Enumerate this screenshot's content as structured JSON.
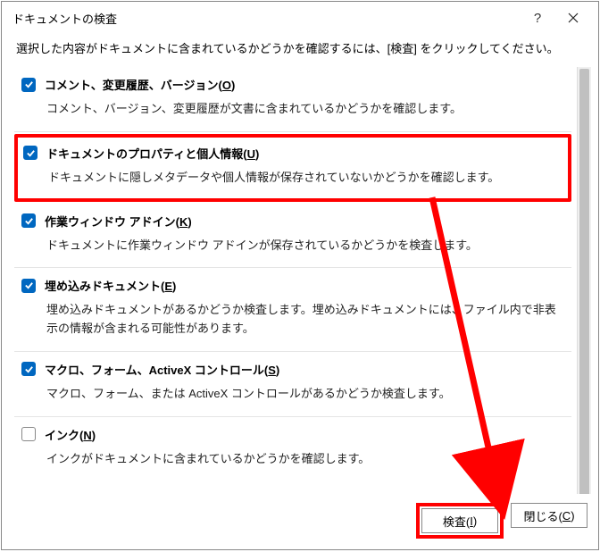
{
  "title": "ドキュメントの検査",
  "instruction": "選択した内容がドキュメントに含まれているかどうかを確認するには、[検査] をクリックしてください。",
  "items": [
    {
      "checked": true,
      "highlighted": false,
      "title_pre": "コメント、変更履歴、バージョン(",
      "title_key": "O",
      "title_post": ")",
      "desc": "コメント、バージョン、変更履歴が文書に含まれているかどうかを確認します。"
    },
    {
      "checked": true,
      "highlighted": true,
      "title_pre": "ドキュメントのプロパティと個人情報(",
      "title_key": "U",
      "title_post": ")",
      "desc": "ドキュメントに隠しメタデータや個人情報が保存されていないかどうかを確認します。"
    },
    {
      "checked": true,
      "highlighted": false,
      "title_pre": "作業ウィンドウ アドイン(",
      "title_key": "K",
      "title_post": ")",
      "desc": "ドキュメントに作業ウィンドウ アドインが保存されているかどうかを検査します。"
    },
    {
      "checked": true,
      "highlighted": false,
      "title_pre": "埋め込みドキュメント(",
      "title_key": "E",
      "title_post": ")",
      "desc": "埋め込みドキュメントがあるかどうか検査します。埋め込みドキュメントには、ファイル内で非表示の情報が含まれる可能性があります。"
    },
    {
      "checked": true,
      "highlighted": false,
      "title_pre": "マクロ、フォーム、ActiveX コントロール(",
      "title_key": "S",
      "title_post": ")",
      "desc": "マクロ、フォーム、または ActiveX コントロールがあるかどうか検査します。"
    },
    {
      "checked": false,
      "highlighted": false,
      "title_pre": "インク(",
      "title_key": "N",
      "title_post": ")",
      "desc": "インクがドキュメントに含まれているかどうかを確認します。"
    }
  ],
  "buttons": {
    "inspect_pre": "検査(",
    "inspect_key": "I",
    "inspect_post": ")",
    "close_pre": "閉じる(",
    "close_key": "C",
    "close_post": ")"
  }
}
